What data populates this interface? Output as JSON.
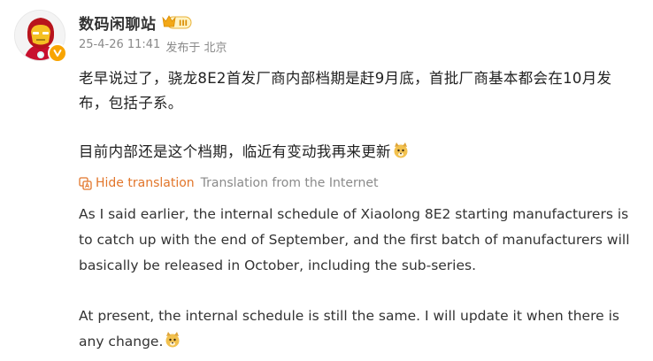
{
  "user": {
    "name": "数码闲聊站",
    "vip_badge": "III"
  },
  "meta": {
    "date": "25-4-26 11:41",
    "source": "发布于 北京"
  },
  "post": {
    "paragraph1": "老早说过了，骁龙8E2首发厂商内部档期是赶9月底，首批厂商基本都会在10月发布，包括子系。",
    "paragraph2": "目前内部还是这个档期，临近有变动我再来更新"
  },
  "translation": {
    "hide_label": "Hide translation",
    "source_label": "Translation from the Internet",
    "paragraph1": "As I said earlier, the internal schedule of Xiaolong 8E2 starting manufacturers is to catch up with the end of September, and the first batch of manufacturers will basically be released in October, including the sub-series.",
    "paragraph2": "At present, the internal schedule is still the same. I will update it when there is any change."
  },
  "icons": {
    "avatar": "iron-man-avatar",
    "verified": "verified-badge-icon",
    "vip": "vip-crown-badge-icon",
    "emoji": "doge-emoji-icon",
    "translate": "translate-icon"
  },
  "colors": {
    "accent_orange": "#e2762b",
    "meta_gray": "#8a8a8a",
    "verified": "#f8a400"
  }
}
